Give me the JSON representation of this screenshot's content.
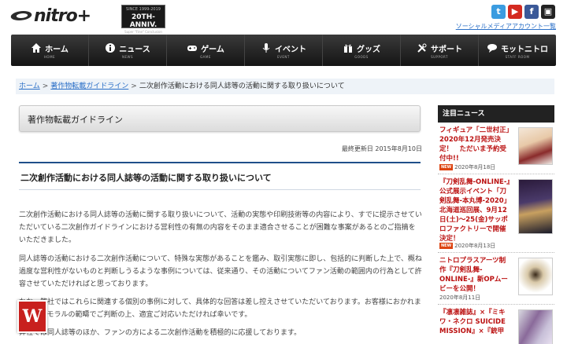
{
  "header": {
    "logo_text": "nitro+",
    "anniversary": {
      "since": "SINCE 1999-2019",
      "title": "20TH-ANNIV.",
      "subtitle": "Super \"Fine\" Conclusion"
    },
    "social_icons": [
      "twitter-icon",
      "youtube-icon",
      "facebook-icon",
      "niconico-icon"
    ],
    "social_glyphs": [
      "t",
      "▶",
      "f",
      "▣"
    ],
    "social_link": "ソーシャルメディアアカウント一覧"
  },
  "nav": [
    {
      "label": "ホーム",
      "sub": "HOME",
      "icon": "home-icon"
    },
    {
      "label": "ニュース",
      "sub": "NEWS",
      "icon": "info-icon"
    },
    {
      "label": "ゲーム",
      "sub": "GAME",
      "icon": "gamepad-icon"
    },
    {
      "label": "イベント",
      "sub": "EVENT",
      "icon": "microphone-icon"
    },
    {
      "label": "グッズ",
      "sub": "GOODS",
      "icon": "gift-icon"
    },
    {
      "label": "サポート",
      "sub": "SUPPORT",
      "icon": "tools-icon"
    },
    {
      "label": "モットニトロ",
      "sub": "STAFF ROOM",
      "icon": "speech-icon"
    }
  ],
  "breadcrumb": {
    "home": "ホーム",
    "guideline": "著作物転載ガイドライン",
    "current": "二次創作活動における同人誌等の活動に関する取り扱いについて",
    "separator": ">"
  },
  "main": {
    "section_title": "著作物転載ガイドライン",
    "updated": "最終更新日 2015年8月10日",
    "article_title": "二次創作活動における同人誌等の活動に関する取り扱いについて",
    "paragraphs": [
      "二次創作活動における同人誌等の活動に関する取り扱いについて、活動の実態や印刷技術等の内容により、すでに提示させていただいている二次創作ガイドラインにおける営利性の有無の内容をそのまま適合させることが困難な事案があるとのご指摘をいただきました。",
      "同人誌等の活動における二次創作活動について、特殊な実態があることを鑑み、取引実態に即し、包括的に判断した上で、概ね過度な営利性がないものと判断しうるような事例については、従来通り、その活動についてファン活動の範囲内の行為として許容させていただければと思っております。",
      "なお、弊社ではこれらに関連する個別の事例に対して、具体的な回答は差し控えさせていただいております。お客様におかれましては、モラルの範疇でご判断の上、適宜ご対応いただければ幸いです。",
      "弊社では同人誌等のほか、ファンの方による二次創作活動を積極的に応援しております。"
    ]
  },
  "sidebar": {
    "title": "注目ニュース",
    "news": [
      {
        "text": "フィギュア「二世村正」2020年12月発売決定！　ただいま予約受付中!!",
        "date": "2020年8月18日",
        "badge": "NEW"
      },
      {
        "text": "『刀剣乱舞-ONLINE-』公式展示イベント「刀剣乱舞-本丸博-2020」北海道巡回展、9月12日(土)〜25(金)サッポロファクトリーで開催決定！",
        "date": "2020年8月13日",
        "badge": "NEW"
      },
      {
        "text": "ニトロプラスアーツ制作『刀剣乱舞-ONLINE-』新OPムービーを公開！",
        "date": "2020年8月11日",
        "badge": ""
      },
      {
        "text": "『凛凛雑誌』×『ミキワ・ネクロ SUICIDE MISSION』×『銃甲",
        "date": "",
        "badge": ""
      }
    ]
  },
  "widget": {
    "glyph": "W"
  },
  "colors": {
    "nav_bg": "#1f1f1f",
    "link": "#2a6fc7",
    "accent_red": "#c8201e",
    "title_rule": "#1f4f8a"
  }
}
